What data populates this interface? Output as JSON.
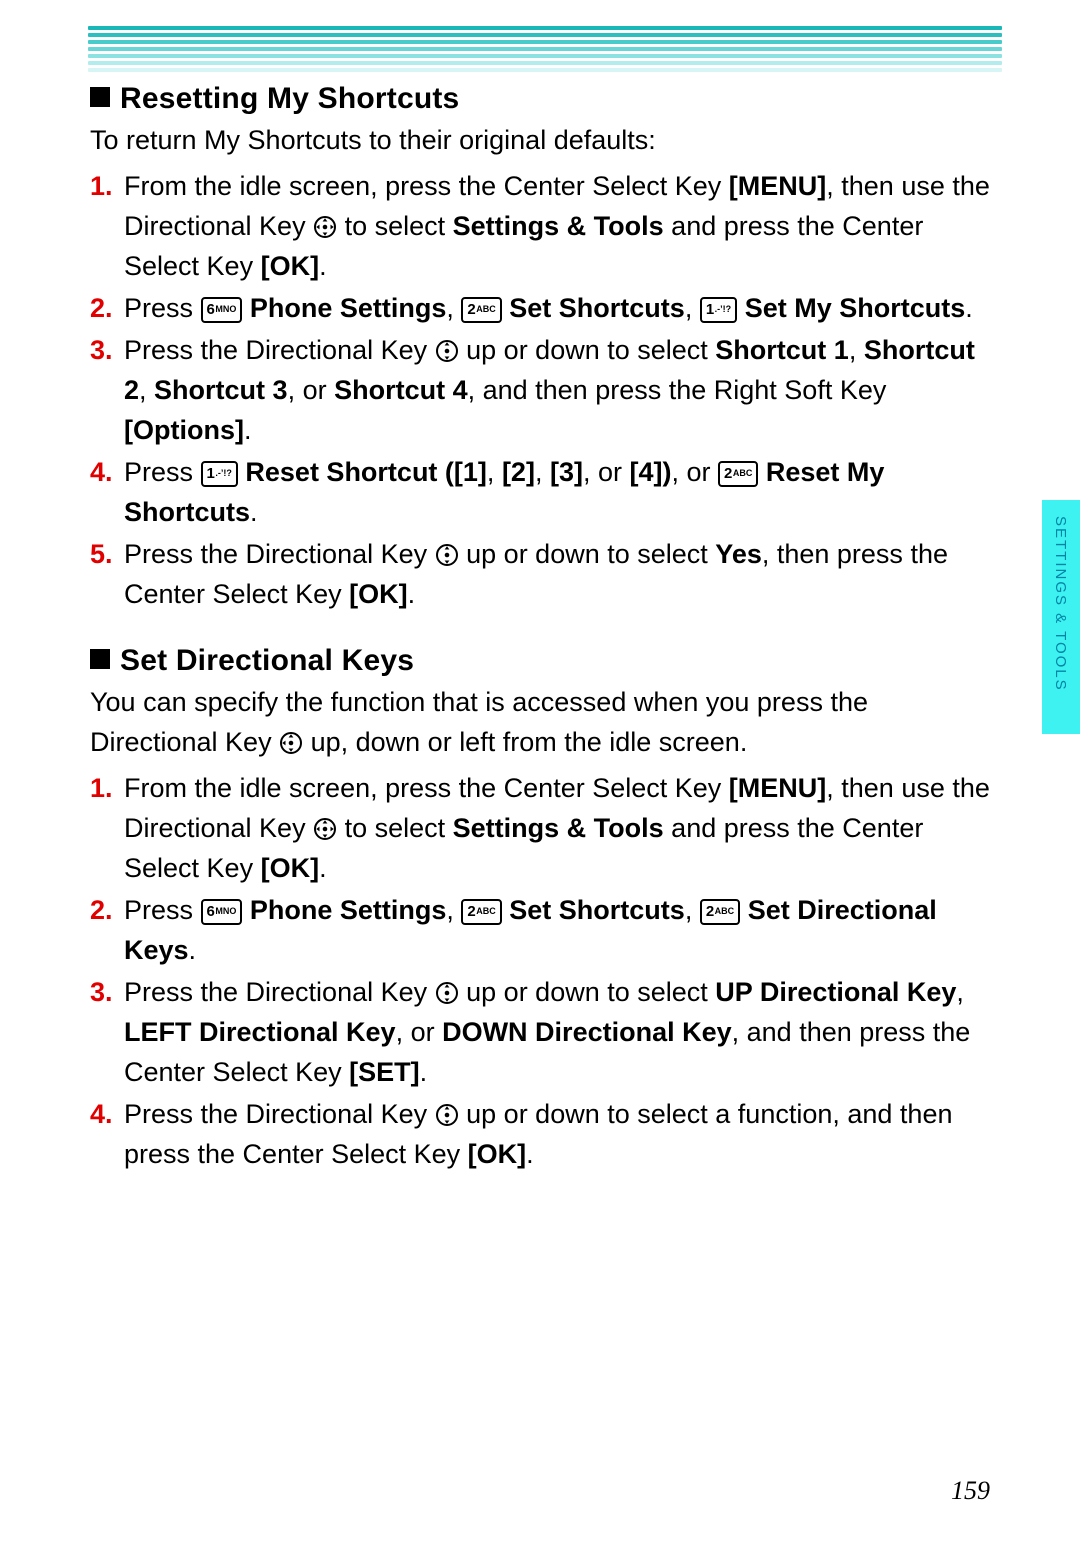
{
  "header_stripes_count": 7,
  "side_tab_label": "SETTINGS & TOOLS",
  "page_number": "159",
  "sec1": {
    "title": "Resetting My Shortcuts",
    "intro": "To return My Shortcuts to their original defaults:",
    "steps": [
      {
        "n": "1.",
        "parts": [
          {
            "t": "From the idle screen, press the Center Select Key "
          },
          {
            "t": "[MENU]",
            "b": true
          },
          {
            "t": ", then use the Directional Key "
          },
          {
            "icon": "dir-all"
          },
          {
            "t": " to select "
          },
          {
            "t": "Settings & Tools",
            "b": true
          },
          {
            "t": " and press the Center Select Key "
          },
          {
            "t": "[OK]",
            "b": true
          },
          {
            "t": "."
          }
        ]
      },
      {
        "n": "2.",
        "parts": [
          {
            "t": "Press "
          },
          {
            "key": {
              "num": "6",
              "sub": "MNO"
            }
          },
          {
            "t": " "
          },
          {
            "t": "Phone Settings",
            "b": true
          },
          {
            "t": ", "
          },
          {
            "key": {
              "num": "2",
              "sub": "ABC"
            }
          },
          {
            "t": " "
          },
          {
            "t": "Set Shortcuts",
            "b": true
          },
          {
            "t": ", "
          },
          {
            "key": {
              "num": "1",
              "sub": ".-’!?"
            }
          },
          {
            "t": " "
          },
          {
            "t": "Set My Shortcuts",
            "b": true
          },
          {
            "t": "."
          }
        ]
      },
      {
        "n": "3.",
        "parts": [
          {
            "t": "Press the Directional Key "
          },
          {
            "icon": "dir-ud"
          },
          {
            "t": " up or down to select "
          },
          {
            "t": "Shortcut 1",
            "b": true
          },
          {
            "t": ", "
          },
          {
            "t": "Shortcut 2",
            "b": true
          },
          {
            "t": ", "
          },
          {
            "t": "Shortcut 3",
            "b": true
          },
          {
            "t": ", or "
          },
          {
            "t": "Shortcut 4",
            "b": true
          },
          {
            "t": ", and then press the Right Soft Key "
          },
          {
            "t": "[Options]",
            "b": true
          },
          {
            "t": "."
          }
        ]
      },
      {
        "n": "4.",
        "parts": [
          {
            "t": "Press "
          },
          {
            "key": {
              "num": "1",
              "sub": ".-’!?"
            }
          },
          {
            "t": " "
          },
          {
            "t": "Reset Shortcut ([1]",
            "b": true
          },
          {
            "t": ", "
          },
          {
            "t": "[2]",
            "b": true
          },
          {
            "t": ", "
          },
          {
            "t": "[3]",
            "b": true
          },
          {
            "t": ", or "
          },
          {
            "t": "[4])",
            "b": true
          },
          {
            "t": ", or "
          },
          {
            "key": {
              "num": "2",
              "sub": "ABC"
            }
          },
          {
            "t": " "
          },
          {
            "t": "Reset My Shortcuts",
            "b": true
          },
          {
            "t": "."
          }
        ]
      },
      {
        "n": "5.",
        "parts": [
          {
            "t": "Press the Directional Key "
          },
          {
            "icon": "dir-ud"
          },
          {
            "t": " up or down to select "
          },
          {
            "t": "Yes",
            "b": true
          },
          {
            "t": ", then press the Center Select Key "
          },
          {
            "t": "[OK]",
            "b": true
          },
          {
            "t": "."
          }
        ]
      }
    ]
  },
  "sec2": {
    "title": "Set Directional Keys",
    "intro_parts": [
      {
        "t": "You can specify the function that is accessed when you press the Directional Key "
      },
      {
        "icon": "dir-udl"
      },
      {
        "t": " up, down or left from the idle screen."
      }
    ],
    "steps": [
      {
        "n": "1.",
        "parts": [
          {
            "t": "From the idle screen, press the Center Select Key "
          },
          {
            "t": "[MENU]",
            "b": true
          },
          {
            "t": ", then use the Directional Key "
          },
          {
            "icon": "dir-all"
          },
          {
            "t": " to select "
          },
          {
            "t": "Settings & Tools",
            "b": true
          },
          {
            "t": " and press the Center Select Key "
          },
          {
            "t": "[OK]",
            "b": true
          },
          {
            "t": "."
          }
        ]
      },
      {
        "n": "2.",
        "parts": [
          {
            "t": "Press "
          },
          {
            "key": {
              "num": "6",
              "sub": "MNO"
            }
          },
          {
            "t": " "
          },
          {
            "t": "Phone Settings",
            "b": true
          },
          {
            "t": ", "
          },
          {
            "key": {
              "num": "2",
              "sub": "ABC"
            }
          },
          {
            "t": " "
          },
          {
            "t": "Set Shortcuts",
            "b": true
          },
          {
            "t": ", "
          },
          {
            "key": {
              "num": "2",
              "sub": "ABC"
            }
          },
          {
            "t": " "
          },
          {
            "t": "Set Directional Keys",
            "b": true
          },
          {
            "t": "."
          }
        ]
      },
      {
        "n": "3.",
        "parts": [
          {
            "t": "Press the Directional Key "
          },
          {
            "icon": "dir-ud"
          },
          {
            "t": " up or down to select "
          },
          {
            "t": "UP Directional Key",
            "b": true
          },
          {
            "t": ", "
          },
          {
            "t": "LEFT Directional Key",
            "b": true
          },
          {
            "t": ", or "
          },
          {
            "t": "DOWN Directional Key",
            "b": true
          },
          {
            "t": ", and then press the Center Select Key "
          },
          {
            "t": "[SET]",
            "b": true
          },
          {
            "t": "."
          }
        ]
      },
      {
        "n": "4.",
        "parts": [
          {
            "t": "Press the Directional Key "
          },
          {
            "icon": "dir-ud"
          },
          {
            "t": " up or down to select a function, and then press the Center Select Key "
          },
          {
            "t": "[OK]",
            "b": true
          },
          {
            "t": "."
          }
        ]
      }
    ]
  }
}
